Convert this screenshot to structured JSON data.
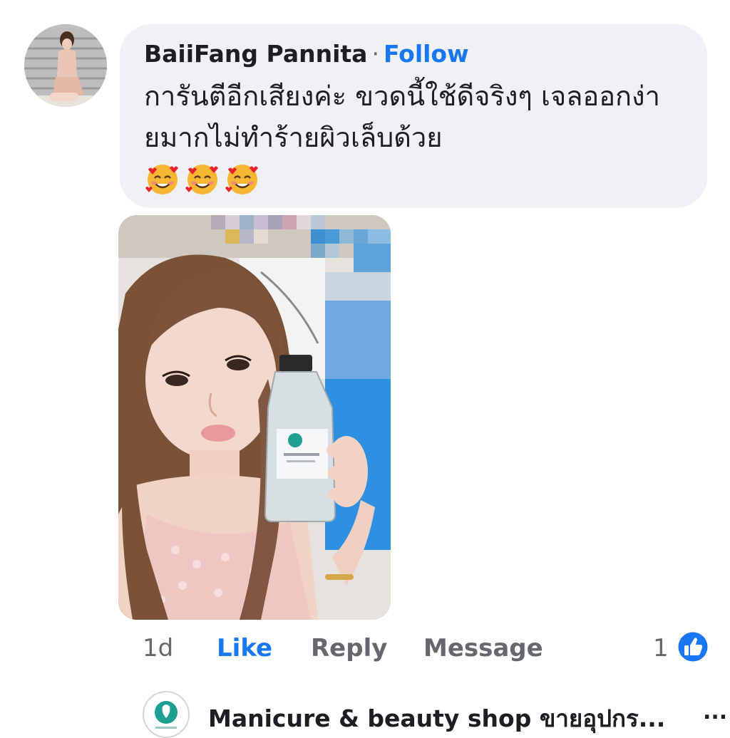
{
  "comment": {
    "author": "BaiiFang Pannita",
    "separator": "·",
    "follow_label": "Follow",
    "text": "การันตีอีกเสียงค่ะ ขวดนี้ใช้ดีจริงๆ เจลออกง่ายมากไม่ทำร้ายผิวเล็บด้วย",
    "emojis": [
      "smiling-face-with-hearts",
      "smiling-face-with-hearts",
      "smiling-face-with-hearts"
    ],
    "photo_icon": "photo-of-woman-holding-bottle"
  },
  "actions": {
    "time": "1d",
    "like_label": "Like",
    "reply_label": "Reply",
    "message_label": "Message",
    "reaction_count": "1",
    "reaction_icon": "thumbs-up-icon"
  },
  "reply": {
    "author": "Manicure & beauty shop ขายอุปกร...",
    "more_label": "..."
  },
  "colors": {
    "accent": "#1877f2",
    "bubble": "#eff1f4",
    "muted": "#65676b"
  }
}
